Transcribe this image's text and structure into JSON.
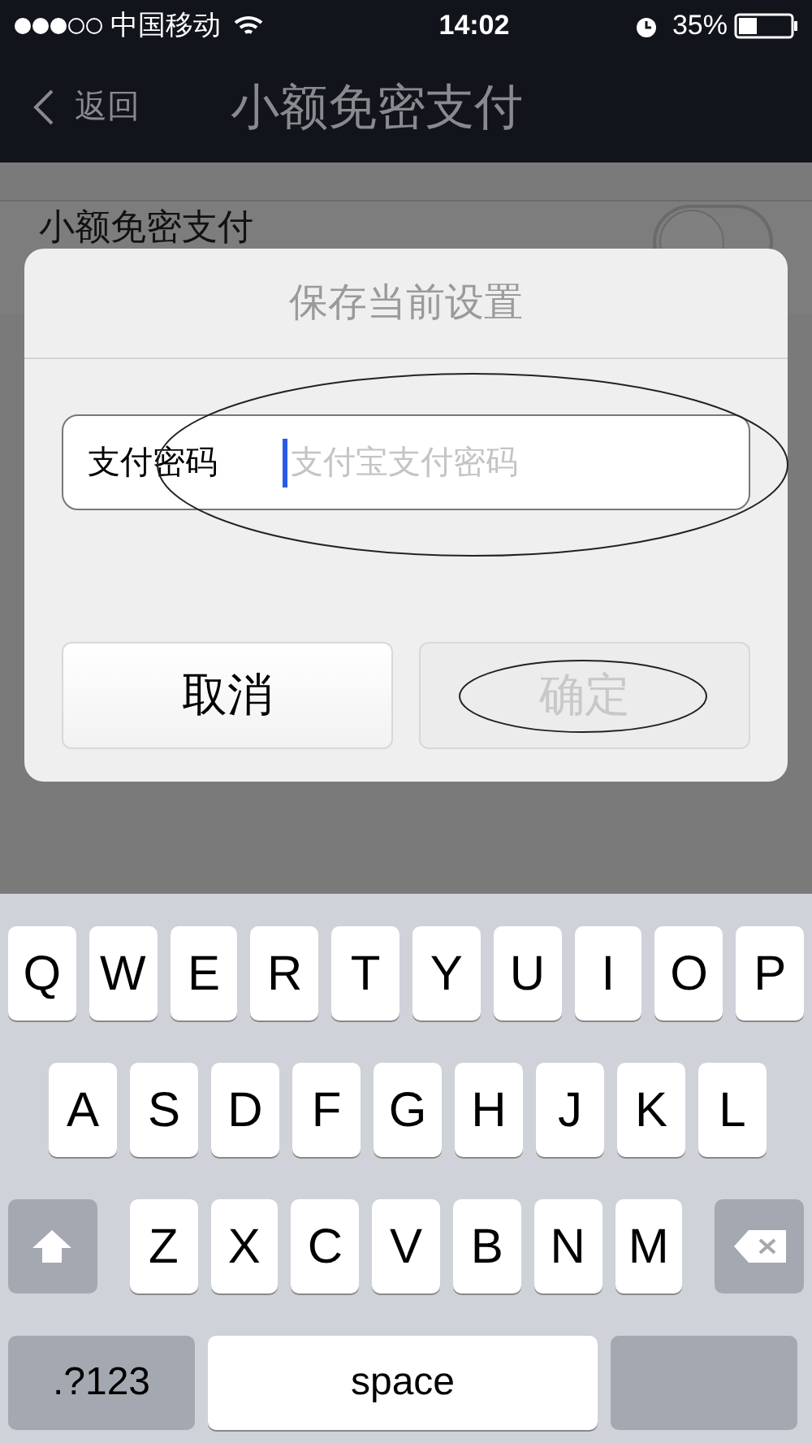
{
  "status_bar": {
    "carrier": "中国移动",
    "time": "14:02",
    "battery": "35%"
  },
  "nav_bar": {
    "back": "返回",
    "title": "小额免密支付"
  },
  "settings_row": {
    "label": "小额免密支付",
    "on": false
  },
  "dialog": {
    "title": "保存当前设置",
    "field": {
      "label": "支付密码",
      "placeholder": "支付宝支付密码"
    },
    "buttons": [
      {
        "label": "取消",
        "disabled": false
      },
      {
        "label": "确定",
        "disabled": true
      }
    ]
  },
  "keyboard": {
    "rows": [
      [
        "Q",
        "W",
        "E",
        "R",
        "T",
        "Y",
        "U",
        "I",
        "O",
        "P"
      ],
      [
        "A",
        "S",
        "D",
        "F",
        "G",
        "H",
        "J",
        "K",
        "L"
      ],
      [
        "Z",
        "X",
        "C",
        "V",
        "B",
        "N",
        "M"
      ]
    ],
    "numbers_key": ".?123",
    "space_key": "space"
  }
}
